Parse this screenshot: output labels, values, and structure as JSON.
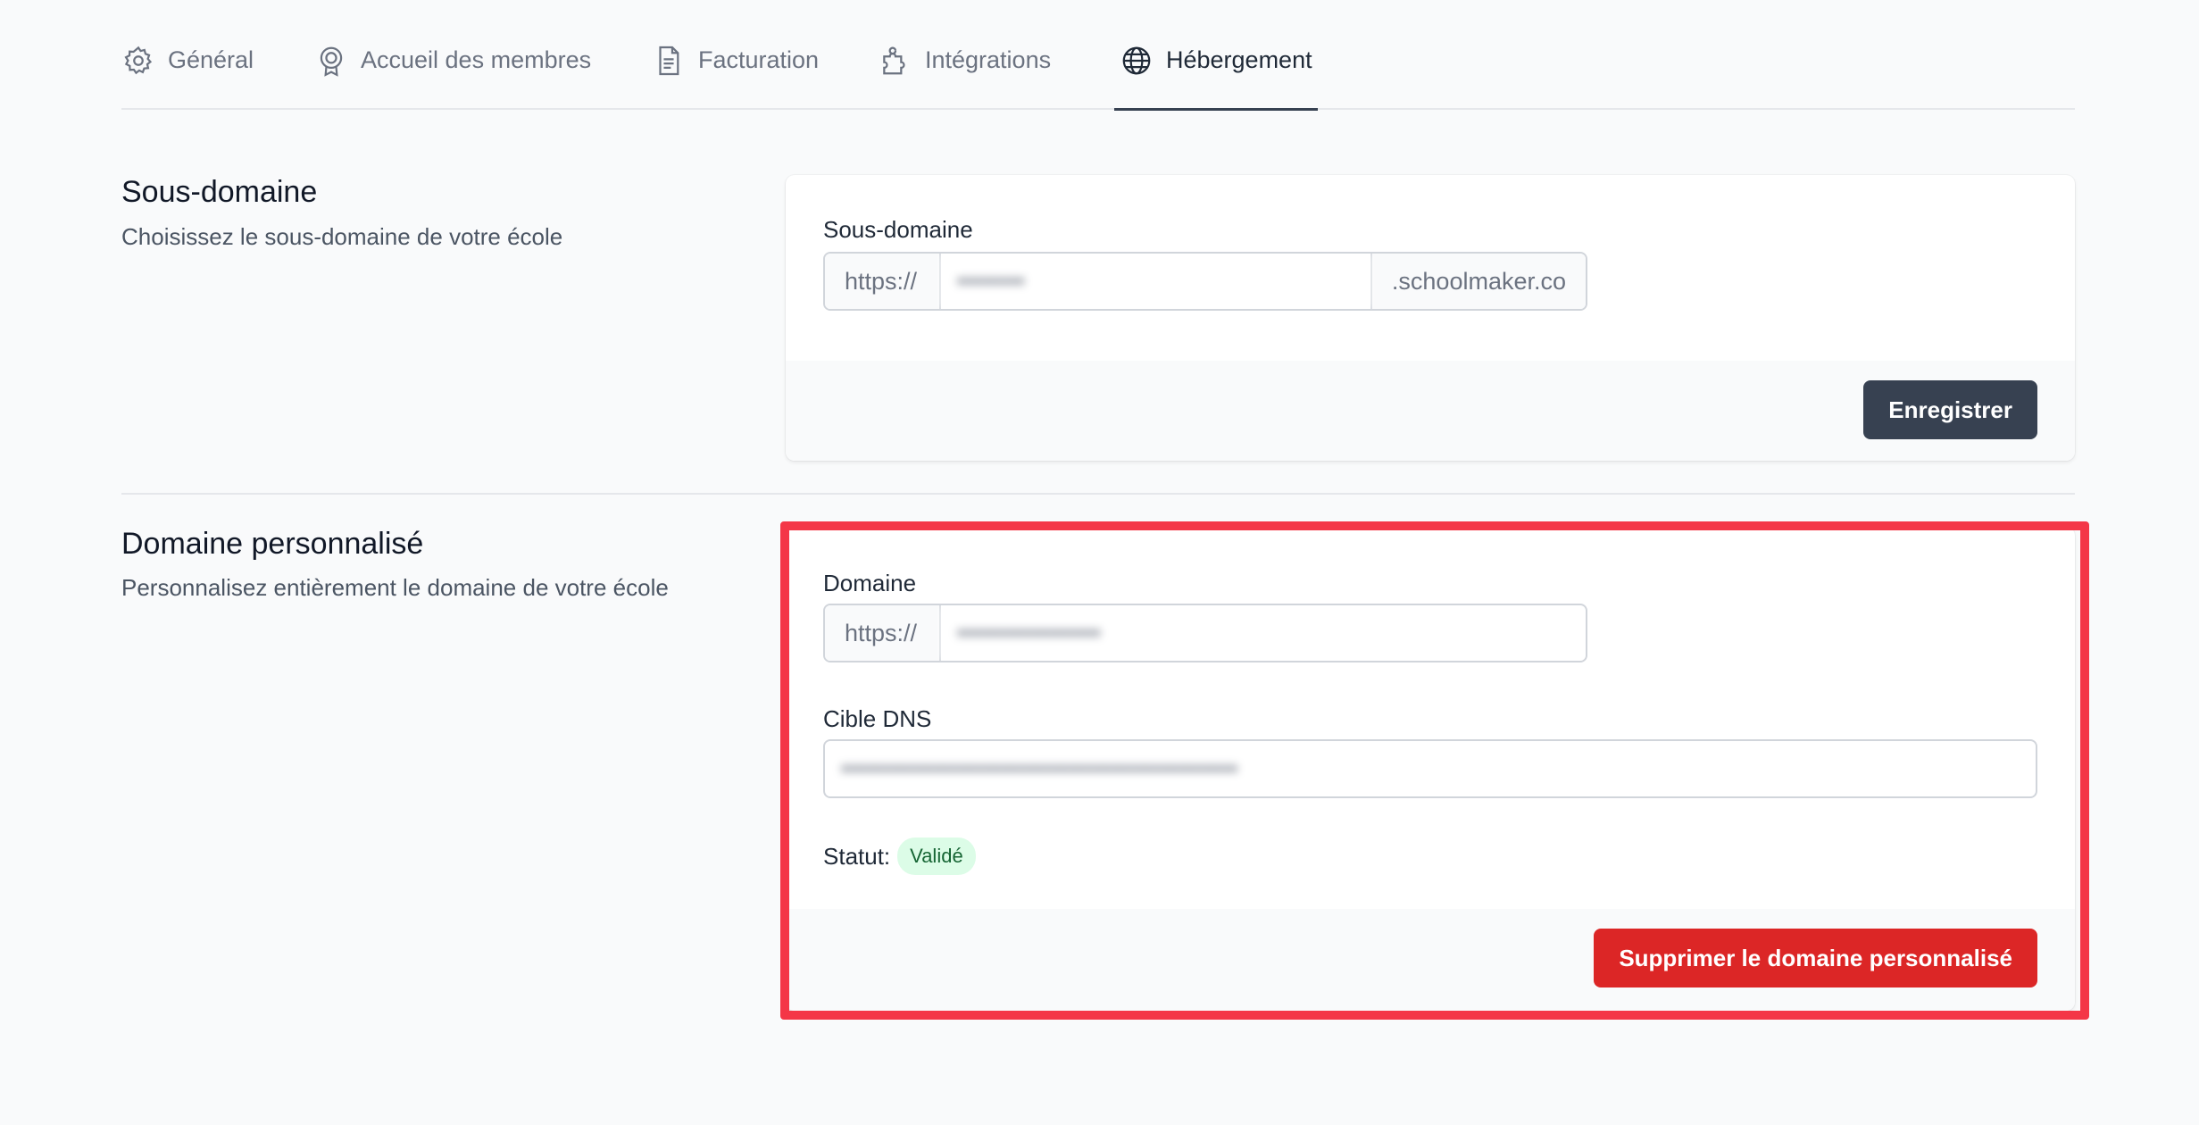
{
  "tabs": [
    {
      "label": "Général",
      "icon": "gear-icon"
    },
    {
      "label": "Accueil des membres",
      "icon": "badge-icon"
    },
    {
      "label": "Facturation",
      "icon": "document-icon"
    },
    {
      "label": "Intégrations",
      "icon": "puzzle-icon"
    },
    {
      "label": "Hébergement",
      "icon": "globe-icon",
      "active": true
    }
  ],
  "subdomain_section": {
    "title": "Sous-domaine",
    "description": "Choisissez le sous-domaine de votre école",
    "field_label": "Sous-domaine",
    "prefix": "https://",
    "value": "••••••••",
    "suffix": ".schoolmaker.co",
    "save_label": "Enregistrer"
  },
  "custom_domain_section": {
    "title": "Domaine personnalisé",
    "description": "Personnalisez entièrement le domaine de votre école",
    "domain_label": "Domaine",
    "domain_prefix": "https://",
    "domain_value": "•••••••••••••••••",
    "dns_label": "Cible DNS",
    "dns_value": "•••••••••••••••••••••••••••••••••••••••••••••••",
    "status_label": "Statut:",
    "status_value": "Validé",
    "delete_label": "Supprimer le domaine personnalisé"
  },
  "colors": {
    "accent_dark": "#374151",
    "danger": "#dc2626",
    "highlight": "#f43647",
    "success_bg": "#dcfce7",
    "success_text": "#166534"
  }
}
